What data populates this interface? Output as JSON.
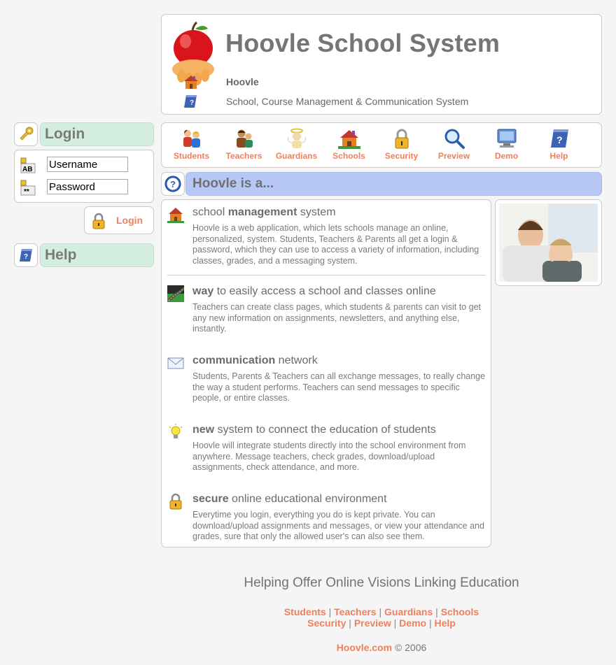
{
  "header": {
    "title": "Hoovle School System",
    "line1": "Hoovle",
    "line2": "School, Course Management & Communication System"
  },
  "nav": [
    {
      "label": "Students",
      "icon": "students-icon"
    },
    {
      "label": "Teachers",
      "icon": "teachers-icon"
    },
    {
      "label": "Guardians",
      "icon": "guardians-icon"
    },
    {
      "label": "Schools",
      "icon": "schools-icon"
    },
    {
      "label": "Security",
      "icon": "lock-icon"
    },
    {
      "label": "Preview",
      "icon": "magnifier-icon"
    },
    {
      "label": "Demo",
      "icon": "monitor-icon"
    },
    {
      "label": "Help",
      "icon": "book-icon"
    }
  ],
  "section_title": "Hoovle is a...",
  "features": [
    {
      "bold": "",
      "pre": "school ",
      "strong": "management",
      "post": " system",
      "body": "Hoovle is a web application, which lets schools manage an online, personalized, system. Students, Teachers & Parents all get a login & password, which they can use to access a variety of information, including classes, grades, and a messaging system."
    },
    {
      "pre": "",
      "strong": "way",
      "post": " to easily access a school and classes online",
      "body": "Teachers can create class pages, which students & parents can visit to get any new information on assignments, newsletters, and anything else, instantly."
    },
    {
      "pre": "",
      "strong": "communication",
      "post": " network",
      "body": "Students, Parents & Teachers can all exchange messages, to really change the way a student performs. Teachers can send messages to specific people, or entire classes."
    },
    {
      "pre": "",
      "strong": "new",
      "post": " system to connect the education of students",
      "body": "Hoovle will integrate students directly into the school environment from anywhere. Message teachers, check grades, download/upload assignments, check attendance, and more."
    },
    {
      "pre": "",
      "strong": "secure",
      "post": " online educational environment",
      "body": "Everytime you login, everything you do is kept private. You can download/upload assignments and messages, or view your attendance and grades, sure that only the allowed user's can also see them."
    }
  ],
  "sidebar": {
    "login_title": "Login",
    "username_value": "Username",
    "password_value": "Password",
    "login_button": "Login",
    "help_title": "Help"
  },
  "footer": {
    "slogan": "Helping Offer Online Visions Linking Education",
    "links_row1": [
      "Students",
      "Teachers",
      "Guardians",
      "Schools"
    ],
    "links_row2": [
      "Security",
      "Preview",
      "Demo",
      "Help"
    ],
    "site": "Hoovle.com",
    "copyright": "© 2006"
  },
  "colors": {
    "accent": "#f07f5a",
    "green_bar": "#d3eedf",
    "blue_bar": "#b7c7f6",
    "title_gray": "#757575"
  }
}
